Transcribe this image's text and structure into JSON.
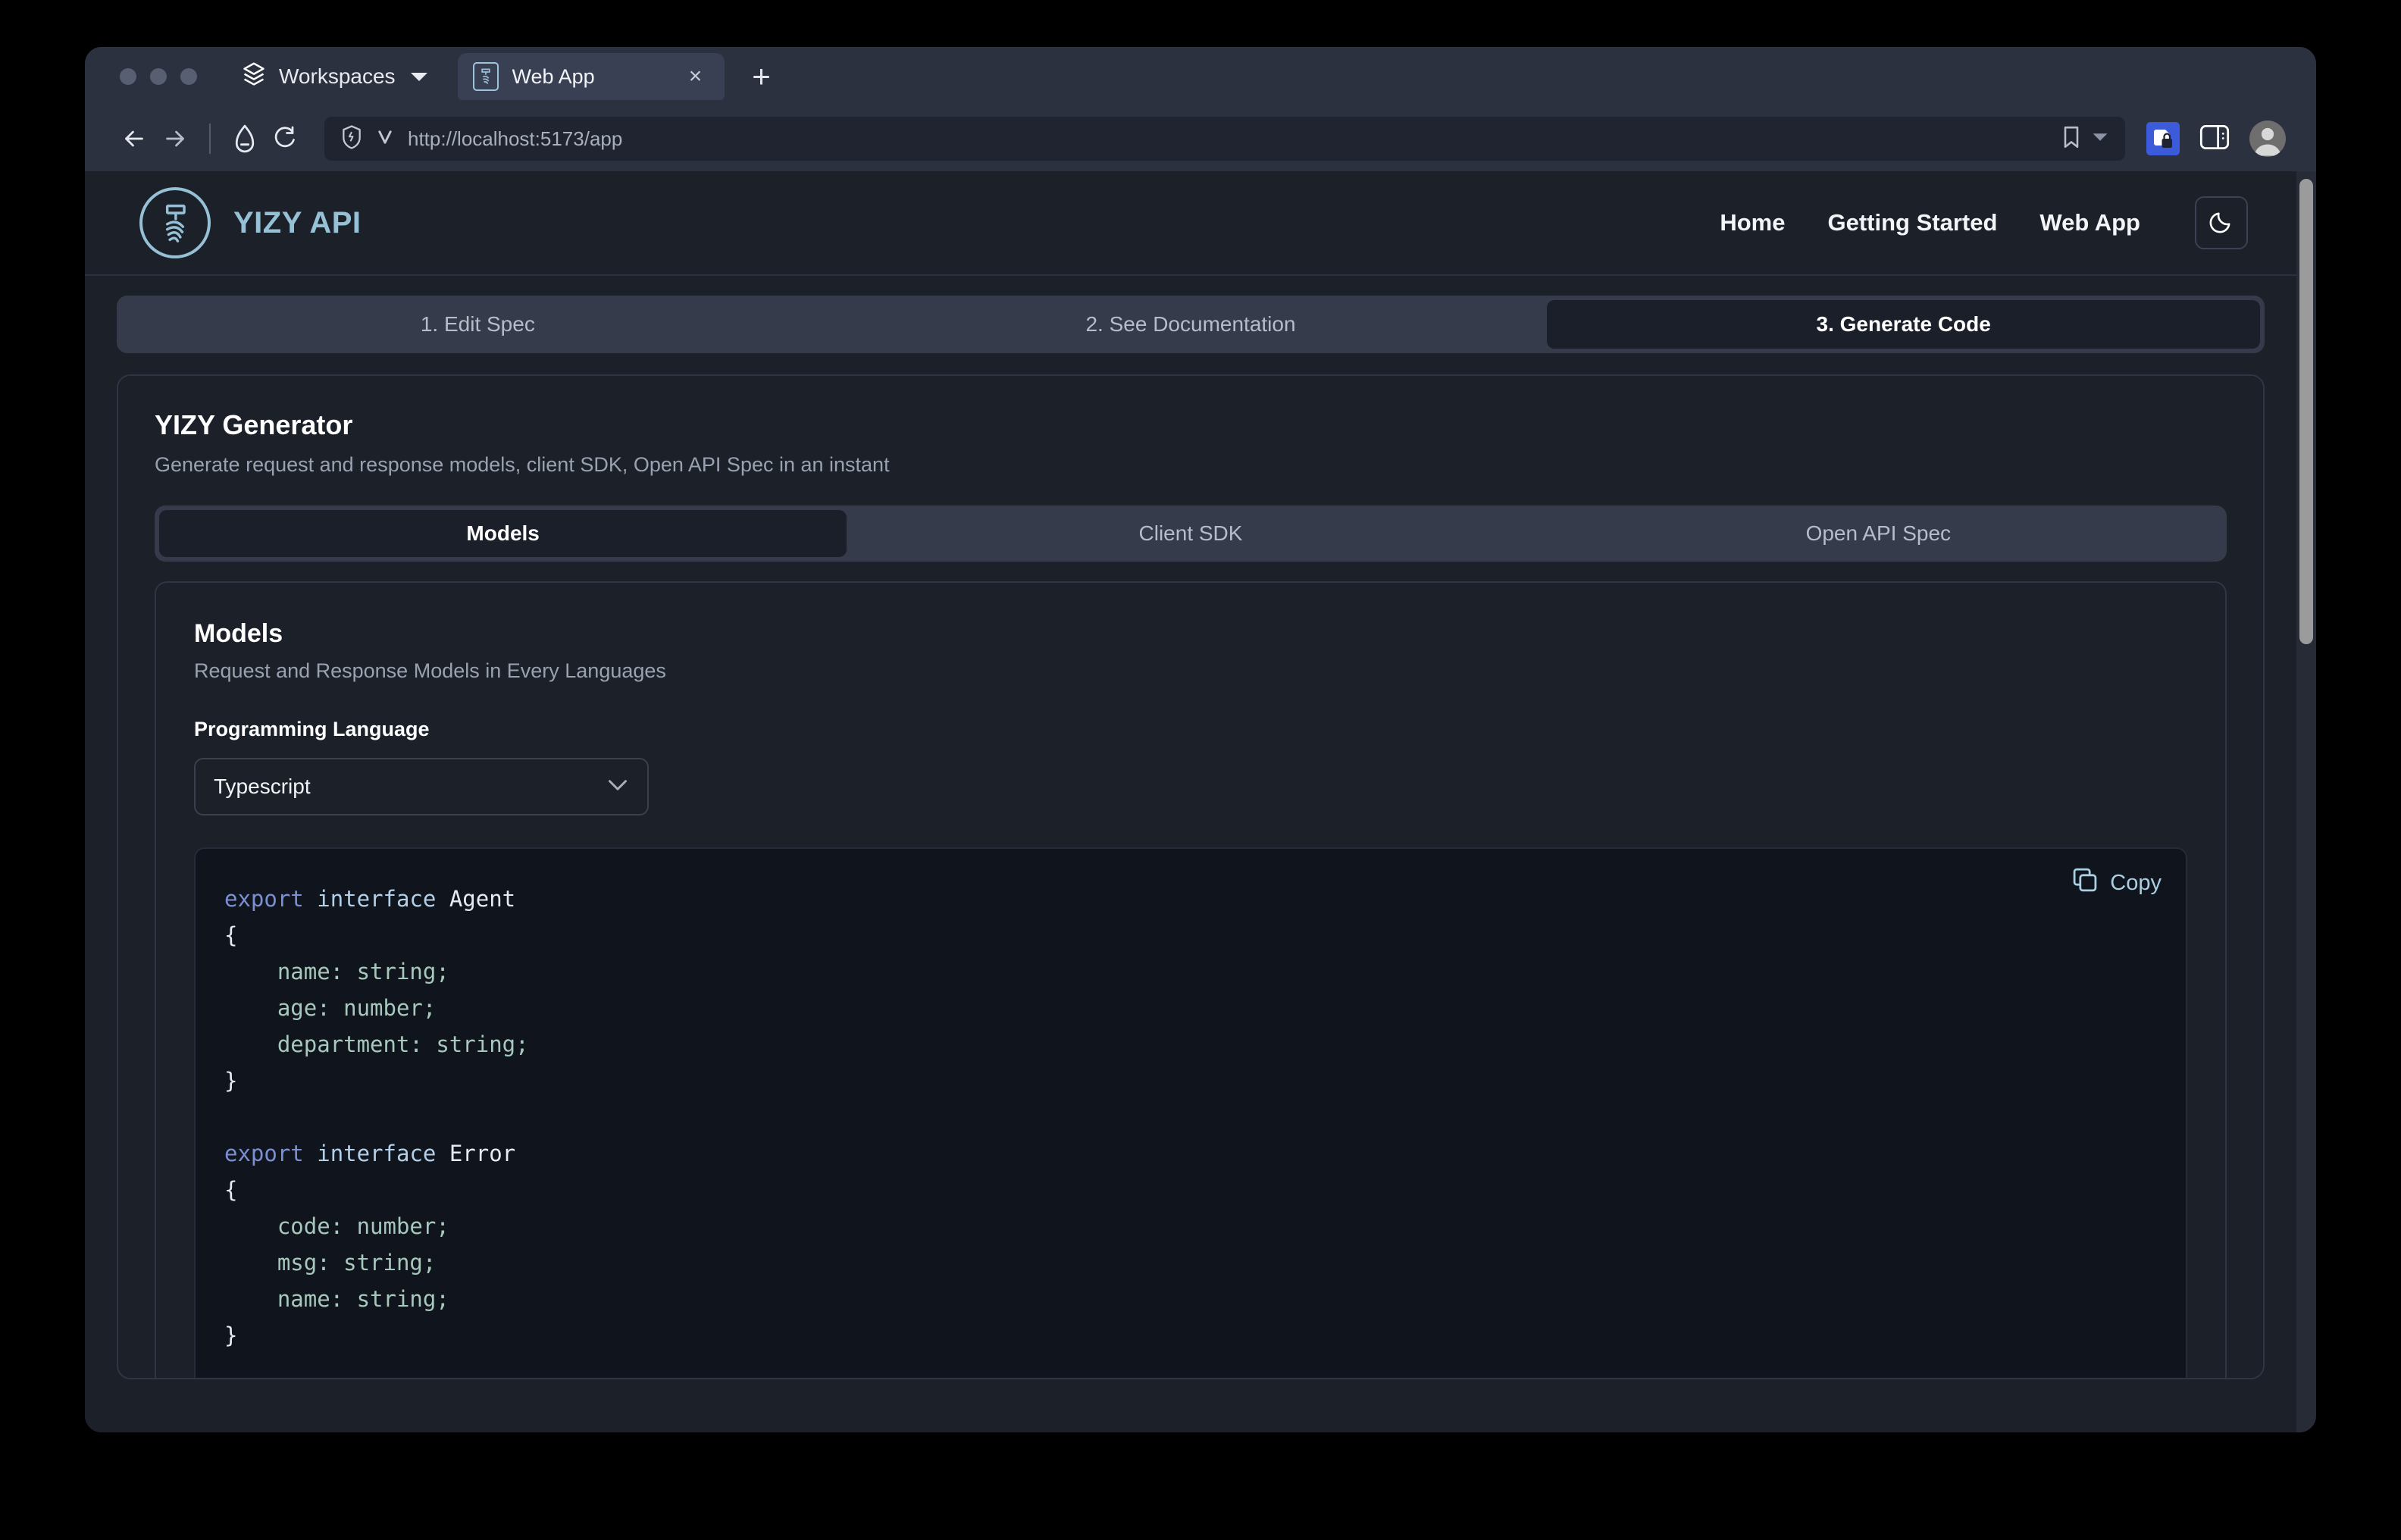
{
  "browser": {
    "workspaces_label": "Workspaces",
    "tab": {
      "title": "Web App",
      "close_label": "×",
      "favicon": "yizy-favicon"
    },
    "new_tab_label": "+",
    "url": "http://localhost:5173/app",
    "nav": {
      "back": "back-arrow",
      "forward": "forward-arrow",
      "home": "home-shield",
      "reload": "reload-arrow"
    },
    "toolbar_icons": [
      "bookmark-icon",
      "bookmark-dropdown-caret",
      "extension-lock-icon",
      "split-panel-icon",
      "profile-avatar"
    ]
  },
  "site": {
    "brand": {
      "name": "YIZY API",
      "mark": "yizy-logo-icon",
      "color": "#96c0d6"
    },
    "nav_links": [
      {
        "label": "Home",
        "name": "nav-home"
      },
      {
        "label": "Getting Started",
        "name": "nav-getting-started"
      },
      {
        "label": "Web App",
        "name": "nav-web-app"
      }
    ],
    "theme_toggle": {
      "icon": "moon-icon"
    }
  },
  "steps": {
    "items": [
      {
        "label": "1. Edit Spec",
        "active": false
      },
      {
        "label": "2. See Documentation",
        "active": false
      },
      {
        "label": "3. Generate Code",
        "active": true
      }
    ]
  },
  "generator": {
    "title": "YIZY Generator",
    "subtitle": "Generate request and response models, client SDK, Open API Spec in an instant",
    "tabs": [
      {
        "label": "Models",
        "active": true
      },
      {
        "label": "Client SDK",
        "active": false
      },
      {
        "label": "Open API Spec",
        "active": false
      }
    ]
  },
  "models_panel": {
    "title": "Models",
    "subtitle": "Request and Response Models in Every Languages",
    "language_label": "Programming Language",
    "language_value": "Typescript",
    "copy_label": "Copy",
    "code_lines": [
      [
        {
          "t": "export",
          "c": "kw"
        },
        {
          "t": " ",
          "c": "punc"
        },
        {
          "t": "interface",
          "c": "kw2"
        },
        {
          "t": " ",
          "c": "punc"
        },
        {
          "t": "Agent",
          "c": "typ"
        }
      ],
      [
        {
          "t": "{",
          "c": "punc"
        }
      ],
      [
        {
          "t": "    name: string;",
          "c": "prop"
        }
      ],
      [
        {
          "t": "    age: number;",
          "c": "prop"
        }
      ],
      [
        {
          "t": "    department: string;",
          "c": "prop"
        }
      ],
      [
        {
          "t": "}",
          "c": "punc"
        }
      ],
      [
        {
          "t": "",
          "c": "punc"
        }
      ],
      [
        {
          "t": "export",
          "c": "kw"
        },
        {
          "t": " ",
          "c": "punc"
        },
        {
          "t": "interface",
          "c": "kw2"
        },
        {
          "t": " ",
          "c": "punc"
        },
        {
          "t": "Error",
          "c": "typ"
        }
      ],
      [
        {
          "t": "{",
          "c": "punc"
        }
      ],
      [
        {
          "t": "    code: number;",
          "c": "prop"
        }
      ],
      [
        {
          "t": "    msg: string;",
          "c": "prop"
        }
      ],
      [
        {
          "t": "    name: string;",
          "c": "prop"
        }
      ],
      [
        {
          "t": "}",
          "c": "punc"
        }
      ]
    ]
  },
  "colors": {
    "page_bg": "#1b2029",
    "chrome_bg": "#2c313f",
    "tabs_bg": "#353b4a",
    "active_tab_bg": "#1a1f2a",
    "code_bg": "#10141c",
    "accent": "#96c0d6"
  }
}
